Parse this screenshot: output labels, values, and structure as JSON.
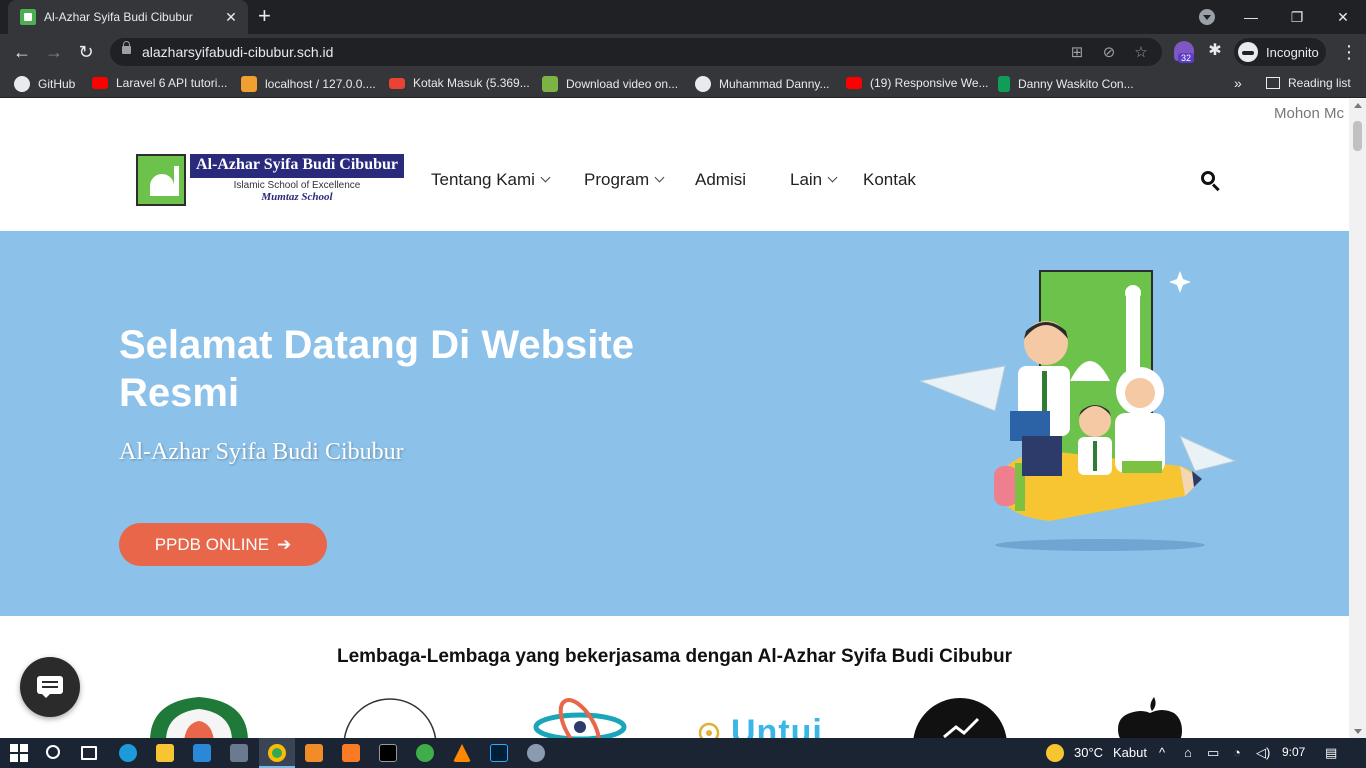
{
  "browser": {
    "tab_title": "Al-Azhar Syifa Budi Cibubur",
    "url": "alazharsyifabudi-cibubur.sch.id",
    "extension_badge": "32",
    "profile_label": "Incognito",
    "bookmarks": [
      {
        "label": "GitHub",
        "icon_color": "#e8eaed"
      },
      {
        "label": "Laravel 6 API tutori...",
        "icon_color": "#ff0000"
      },
      {
        "label": "localhost / 127.0.0....",
        "icon_color": "#f0a030"
      },
      {
        "label": "Kotak Masuk (5.369...",
        "icon_color": "#ea4335"
      },
      {
        "label": "Download video on...",
        "icon_color": "#7cb342"
      },
      {
        "label": "Muhammad Danny...",
        "icon_color": "#e8eaed"
      },
      {
        "label": "(19) Responsive We...",
        "icon_color": "#ff0000"
      },
      {
        "label": "Danny Waskito Con...",
        "icon_color": "#0f9d58"
      }
    ],
    "bookmarks_more": "»",
    "reading_list": "Reading list"
  },
  "site": {
    "marquee": "Mohon Mc",
    "logo": {
      "name": "Al-Azhar Syifa Budi Cibubur",
      "tagline": "Islamic School of Excellence",
      "subtitle": "Mumtaz School"
    },
    "nav": [
      {
        "label": "Tentang Kami",
        "dropdown": true
      },
      {
        "label": "Program",
        "dropdown": true
      },
      {
        "label": "Admisi",
        "dropdown": false
      },
      {
        "label": "Lain",
        "dropdown": true
      },
      {
        "label": "Kontak",
        "dropdown": false
      }
    ],
    "hero": {
      "title": "Selamat Datang Di Website Resmi",
      "subtitle": "Al-Azhar Syifa Budi Cibubur",
      "cta": "PPDB ONLINE",
      "background": "#8cc1e9",
      "cta_color": "#e8664a"
    },
    "partners_title": "Lembaga-Lembaga yang bekerjasama dengan Al-Azhar Syifa Budi Cibubur",
    "partner_logo_text": "Untui"
  },
  "taskbar": {
    "weather": "30°C",
    "weather_label": "Kabut",
    "time": "9:07"
  }
}
